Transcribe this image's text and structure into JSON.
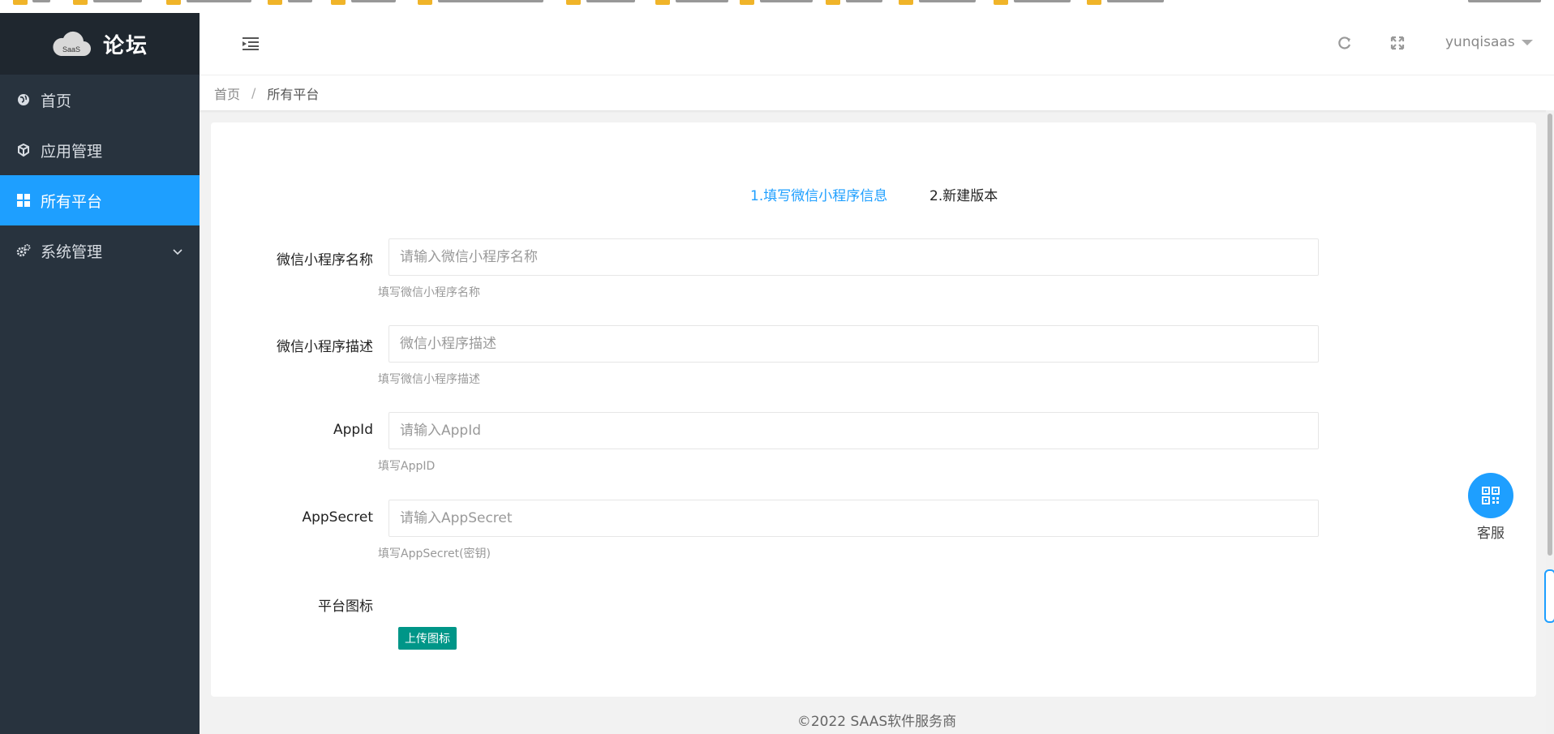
{
  "app": {
    "logo_badge": "SaaS",
    "title": "论坛"
  },
  "sidebar": {
    "items": [
      {
        "label": "首页",
        "icon": "globe-icon"
      },
      {
        "label": "应用管理",
        "icon": "cube-icon"
      },
      {
        "label": "所有平台",
        "icon": "grid-icon",
        "active": true
      },
      {
        "label": "系统管理",
        "icon": "gears-icon",
        "expandable": true
      }
    ]
  },
  "header": {
    "username": "yunqisaas"
  },
  "breadcrumb": {
    "home": "首页",
    "separator": "/",
    "current": "所有平台"
  },
  "steps": [
    {
      "label": "1.填写微信小程序信息",
      "active": true
    },
    {
      "label": "2.新建版本",
      "active": false
    }
  ],
  "form": {
    "name": {
      "label": "微信小程序名称",
      "placeholder": "请输入微信小程序名称",
      "tip": "填写微信小程序名称",
      "value": ""
    },
    "desc": {
      "label": "微信小程序描述",
      "placeholder": "微信小程序描述",
      "tip": "填写微信小程序描述",
      "value": ""
    },
    "appid": {
      "label": "AppId",
      "placeholder": "请输入AppId",
      "tip": "填写AppID",
      "value": ""
    },
    "secret": {
      "label": "AppSecret",
      "placeholder": "请输入AppSecret",
      "tip": "填写AppSecret(密钥)",
      "value": ""
    },
    "icon": {
      "label": "平台图标",
      "button": "上传图标"
    }
  },
  "service": {
    "label": "客服"
  },
  "footer": {
    "text": "©2022 SAAS软件服务商"
  },
  "colors": {
    "sidebar_bg": "#28333e",
    "accent": "#1e9fff",
    "upload_btn": "#009688"
  }
}
